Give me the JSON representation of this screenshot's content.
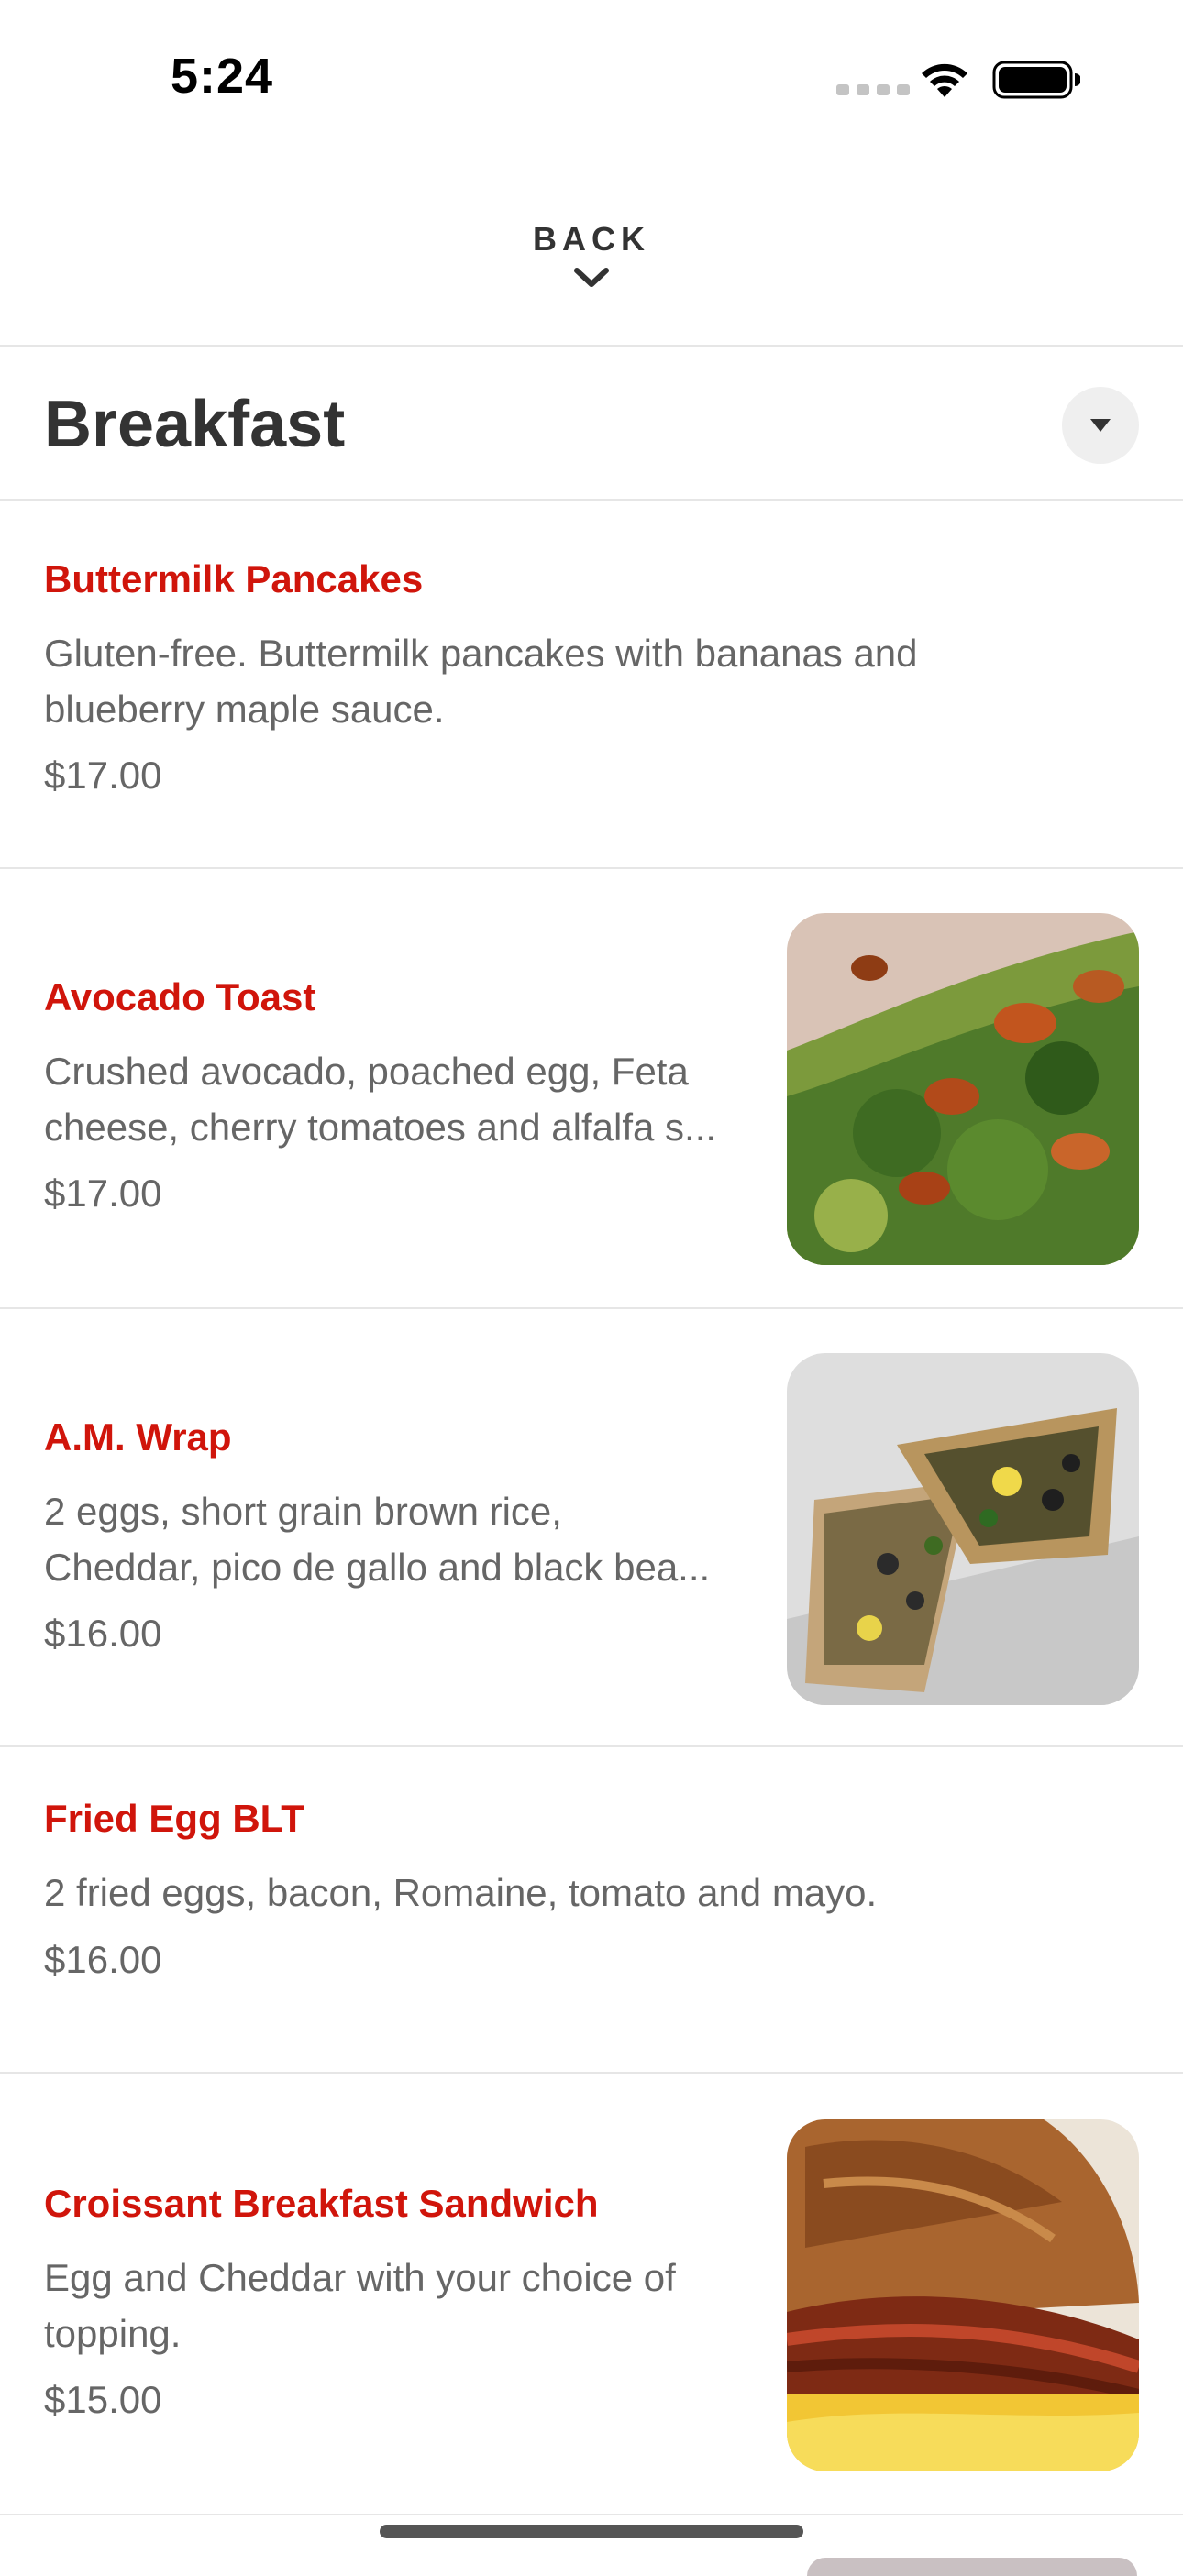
{
  "status_bar": {
    "time": "5:24"
  },
  "header": {
    "back_label": "BACK"
  },
  "section": {
    "title": "Breakfast"
  },
  "items": [
    {
      "name": "Buttermilk Pancakes",
      "desc_line1": "Gluten-free. Buttermilk pancakes with bananas and",
      "desc_line2": "blueberry maple sauce.",
      "price": "$17.00",
      "has_image": false
    },
    {
      "name": "Avocado Toast",
      "desc_line1": "Crushed avocado, poached egg, Feta",
      "desc_line2": "cheese, cherry tomatoes and alfalfa s...",
      "price": "$17.00",
      "has_image": true
    },
    {
      "name": "A.M. Wrap",
      "desc_line1": "2 eggs, short grain brown rice,",
      "desc_line2": "Cheddar, pico de gallo and black bea...",
      "price": "$16.00",
      "has_image": true
    },
    {
      "name": "Fried Egg BLT",
      "desc_line1": "2 fried eggs, bacon, Romaine, tomato and mayo.",
      "price": "$16.00",
      "has_image": false
    },
    {
      "name": "Croissant Breakfast Sandwich",
      "desc_line1": "Egg and Cheddar with your choice of",
      "desc_line2": "topping.",
      "price": "$15.00",
      "has_image": true
    }
  ],
  "colors": {
    "accent": "#d0150b",
    "text": "#333333",
    "muted": "#666666",
    "divider": "#e6e6e6"
  }
}
